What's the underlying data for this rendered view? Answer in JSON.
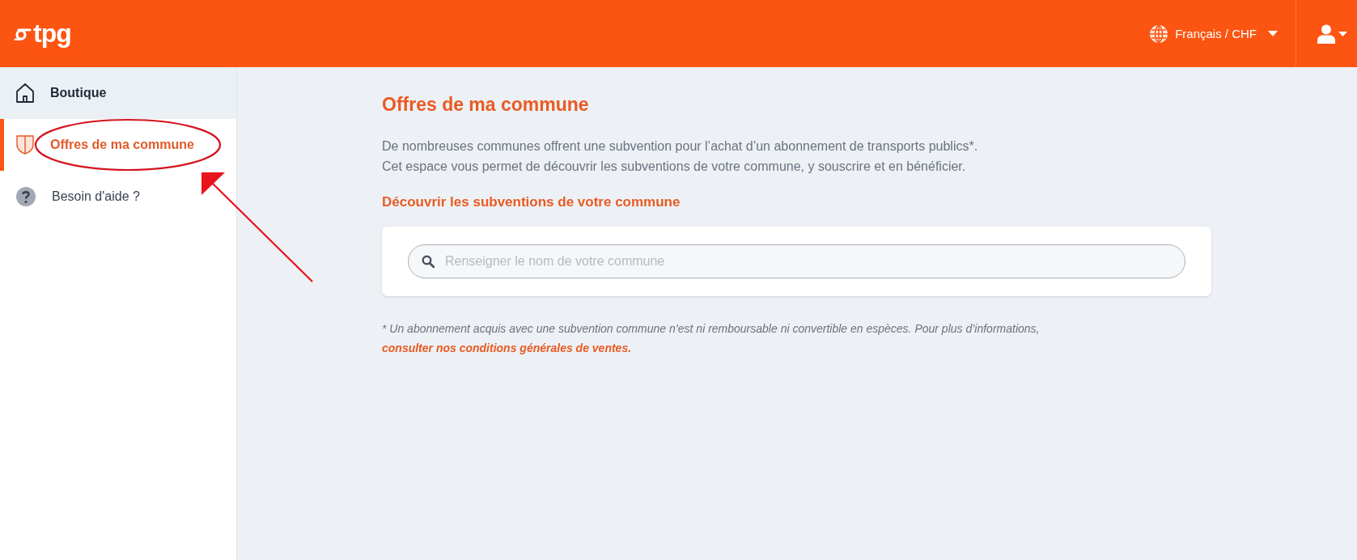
{
  "header": {
    "logo": "tpg",
    "language": "Français / CHF"
  },
  "sidebar": {
    "items": [
      {
        "label": "Boutique",
        "kind": "home",
        "selected": false,
        "hovered": true
      },
      {
        "label": "Offres de ma commune",
        "kind": "shield",
        "selected": true,
        "hovered": false
      },
      {
        "label": "Besoin d'aide ?",
        "kind": "help",
        "selected": false,
        "hovered": false
      }
    ]
  },
  "main": {
    "title": "Offres de ma commune",
    "paragraphs": [
      "De nombreuses communes offrent une subvention pour l’achat d’un abonnement de transports publics*.",
      "Cet espace vous permet de découvrir les subventions de votre commune, y souscrire et en bénéficier."
    ],
    "subtitle": "Découvrir les subventions de votre commune",
    "search": {
      "placeholder": "Renseigner le nom de votre commune"
    },
    "footnote": {
      "text": "* Un abonnement acquis avec une subvention commune n’est ni remboursable ni convertible en espèces. Pour plus d’informations,",
      "link": "consulter nos conditions générales de ventes."
    }
  }
}
